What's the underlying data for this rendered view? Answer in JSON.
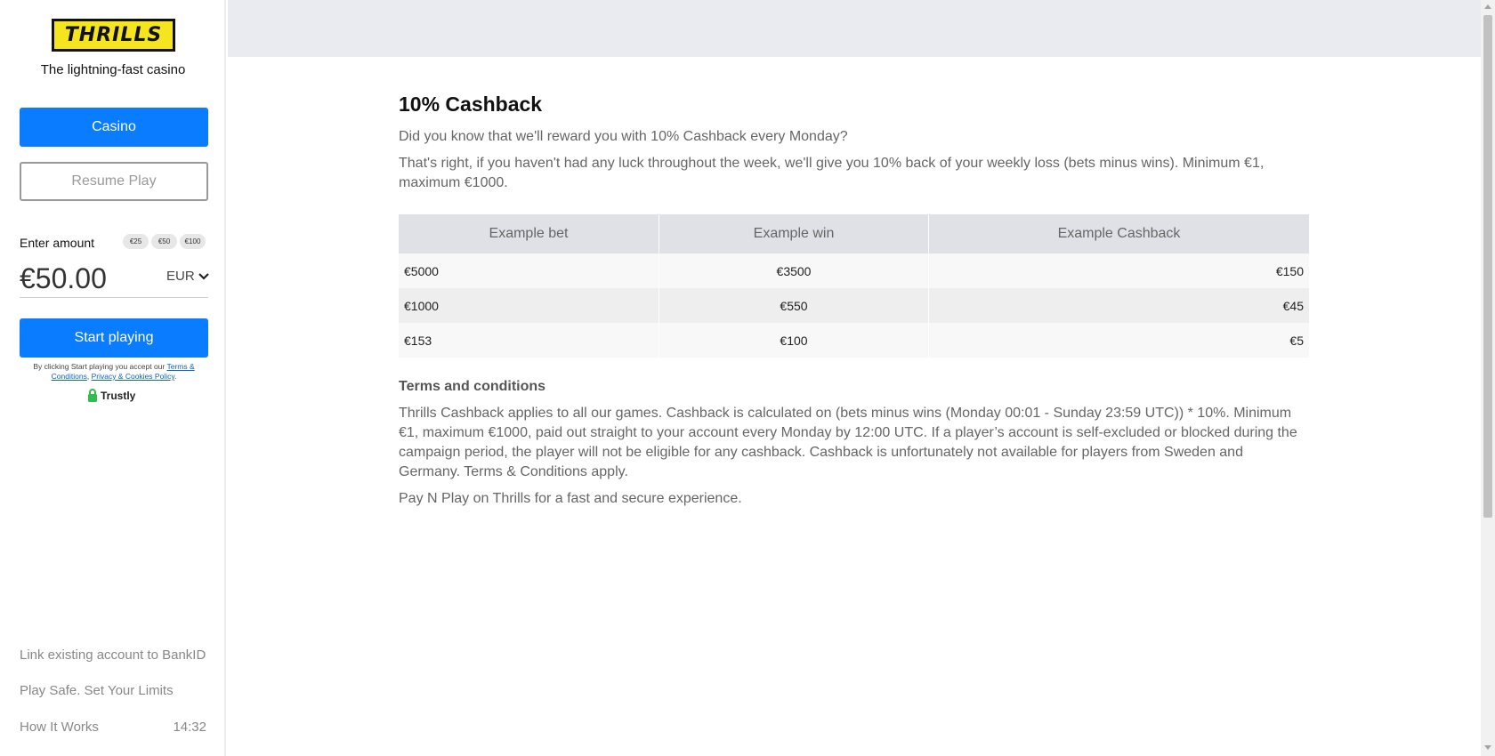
{
  "sidebar": {
    "logo_text": "THRILLS",
    "tagline": "The lightning-fast casino",
    "casino_button": "Casino",
    "resume_button": "Resume Play",
    "amount_label": "Enter amount",
    "chips": [
      "€25",
      "€50",
      "€100"
    ],
    "amount_value": "€50.00",
    "currency": "EUR",
    "start_button": "Start playing",
    "disclaimer_prefix": "By clicking Start playing you accept our",
    "terms_link": "Terms & Conditions",
    "privacy_link": "Privacy & Cookies Policy",
    "payment_brand": "Trustly",
    "links": [
      "Link existing account to BankID",
      "Play Safe. Set Your Limits",
      "How It Works"
    ],
    "time": "14:32"
  },
  "main": {
    "title": "10% Cashback",
    "intro": "Did you know that we'll reward you with 10% Cashback every Monday?",
    "details": "That's right, if you haven't had any luck throughout the week, we'll give you 10% back of your weekly loss (bets minus wins). Minimum €1, maximum €1000.",
    "table": {
      "headers": [
        "Example bet",
        "Example win",
        "Example Cashback"
      ],
      "rows": [
        [
          "€5000",
          "€3500",
          "€150"
        ],
        [
          "€1000",
          "€550",
          "€45"
        ],
        [
          "€153",
          "€100",
          "€5"
        ]
      ]
    },
    "terms_heading": "Terms and conditions",
    "terms_text": "Thrills Cashback applies to all our games. Cashback is calculated on (bets minus wins (Monday 00:01 - Sunday 23:59 UTC)) * 10%. Minimum €1, maximum €1000, paid out straight to your account every Monday by 12:00 UTC. If a player’s account is self-excluded or blocked during the campaign period, the player will not be eligible for any cashback. Cashback is unfortunately not available for players from Sweden and Germany. Terms & Conditions apply.",
    "footer_text": "Pay N Play on Thrills for a fast and secure experience."
  },
  "colors": {
    "primary": "#0a7cff",
    "logo_yellow": "#f5e51e",
    "header_bg": "#e9ebf0"
  }
}
